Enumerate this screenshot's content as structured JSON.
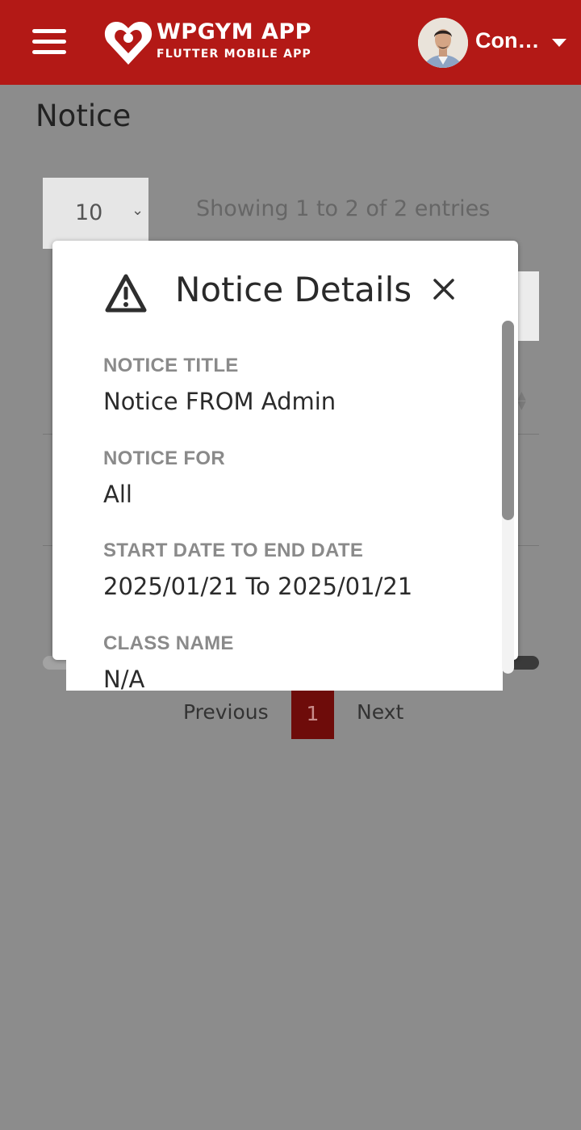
{
  "header": {
    "app_name": "WPGYM APP",
    "app_subtitle": "FLUTTER MOBILE APP",
    "user_name": "Con…",
    "brand_color": "#b31916"
  },
  "page": {
    "title": "Notice",
    "length_value": "10",
    "entries_info": "Showing 1 to 2 of 2 entries"
  },
  "pagination": {
    "previous_label": "Previous",
    "current_page": "1",
    "next_label": "Next"
  },
  "modal": {
    "title": "Notice Details",
    "icon": "warning-icon",
    "fields": [
      {
        "label": "NOTICE TITLE",
        "value": "Notice FROM Admin"
      },
      {
        "label": "NOTICE FOR",
        "value": "All"
      },
      {
        "label": "START DATE TO END DATE",
        "value": "2025/01/21 To 2025/01/21"
      },
      {
        "label": "CLASS NAME",
        "value": "N/A"
      }
    ]
  }
}
